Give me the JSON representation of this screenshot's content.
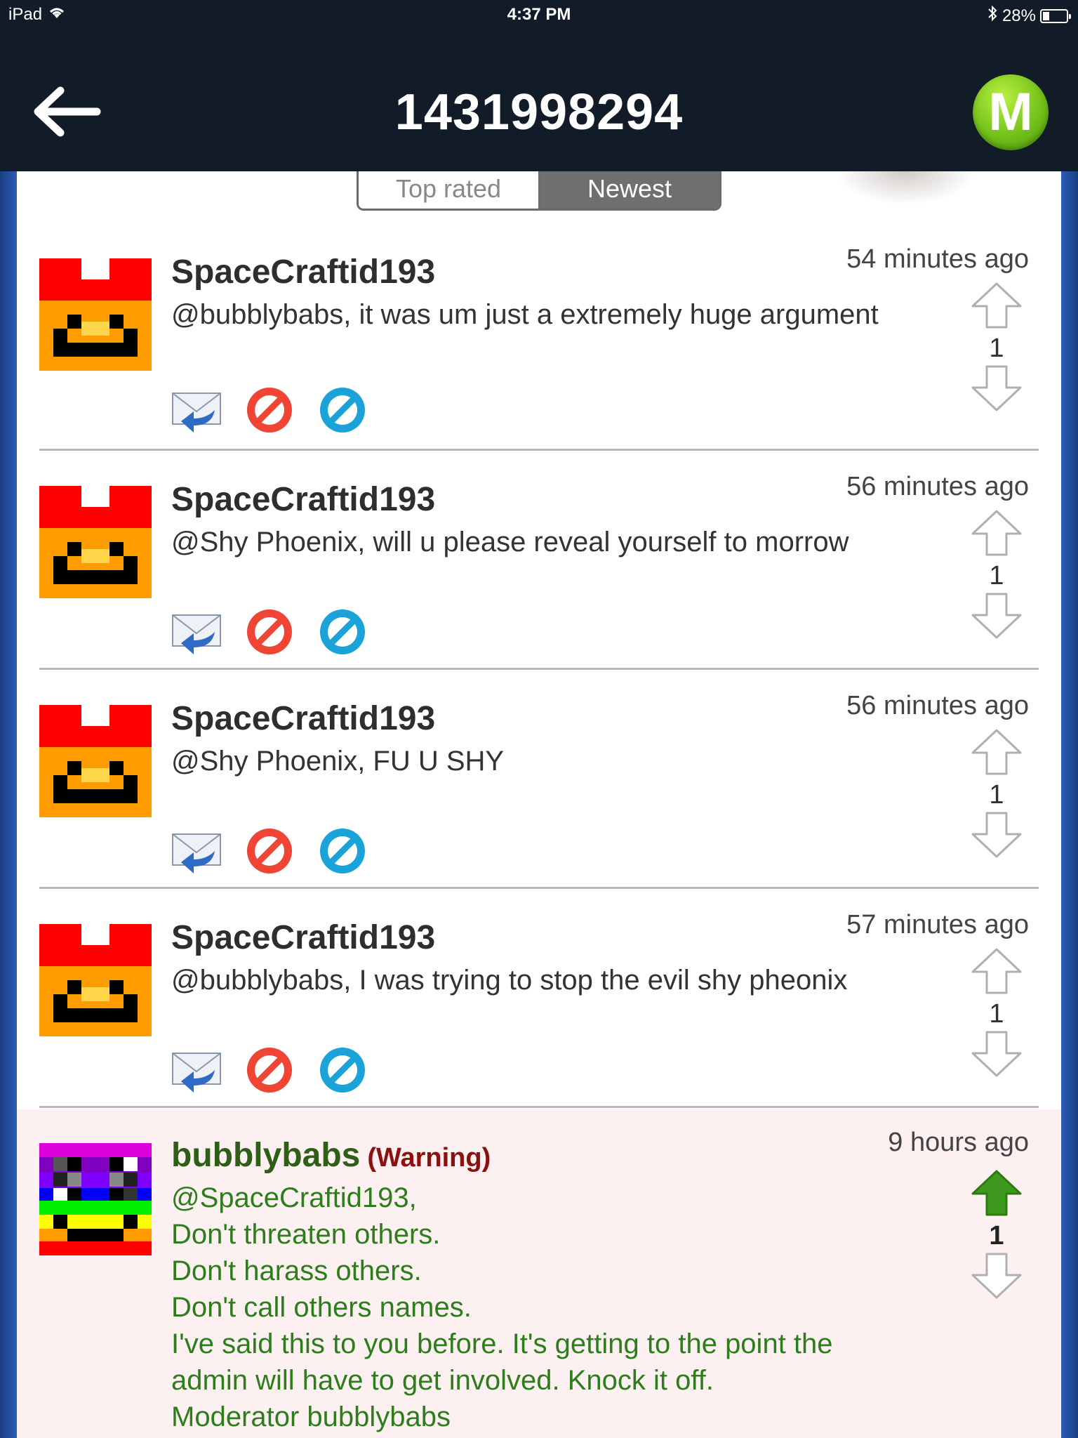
{
  "status": {
    "device": "iPad",
    "time": "4:37 PM",
    "battery": "28%"
  },
  "nav": {
    "title": "1431998294",
    "logo": "M"
  },
  "sort": {
    "top_rated": "Top rated",
    "newest": "Newest",
    "selected": "Newest"
  },
  "comments": [
    {
      "user": "SpaceCraftid193",
      "time": "54 minutes ago",
      "text": "@bubblybabs, it was um just a extremely huge argument",
      "score": "1"
    },
    {
      "user": "SpaceCraftid193",
      "time": "56 minutes ago",
      "text": "@Shy Phoenix, will u please reveal yourself to morrow",
      "score": "1"
    },
    {
      "user": "SpaceCraftid193",
      "time": "56 minutes ago",
      "text": "@Shy Phoenix, FU U SHY",
      "score": "1"
    },
    {
      "user": "SpaceCraftid193",
      "time": "57 minutes ago",
      "text": "@bubblybabs, I was trying to stop the evil shy pheonix",
      "score": "1"
    }
  ],
  "moderator_comment": {
    "user": "bubblybabs",
    "tag": "(Warning)",
    "time": "9 hours ago",
    "score": "1",
    "lines": [
      "@SpaceCraftid193,",
      "Don't threaten others.",
      "Don't harass others.",
      "Don't call others names.",
      "I've said this to you before. It's getting to the point the",
      "admin will have to get involved. Knock it off.",
      "Moderator bubblybabs"
    ]
  },
  "icons": {
    "reply": "reply-mail-icon",
    "flag": "flag-red-icon",
    "block": "block-blue-icon",
    "upvote": "arrow-up-icon",
    "downvote": "arrow-down-icon",
    "back": "back-arrow-icon",
    "logo": "m-logo-icon"
  },
  "colors": {
    "nav_bg": "#111c28",
    "mod_bg": "#fcf0f0",
    "mod_text": "#2e7d1d",
    "warning": "#8b1010",
    "upvote_active": "#3e9a1f"
  }
}
